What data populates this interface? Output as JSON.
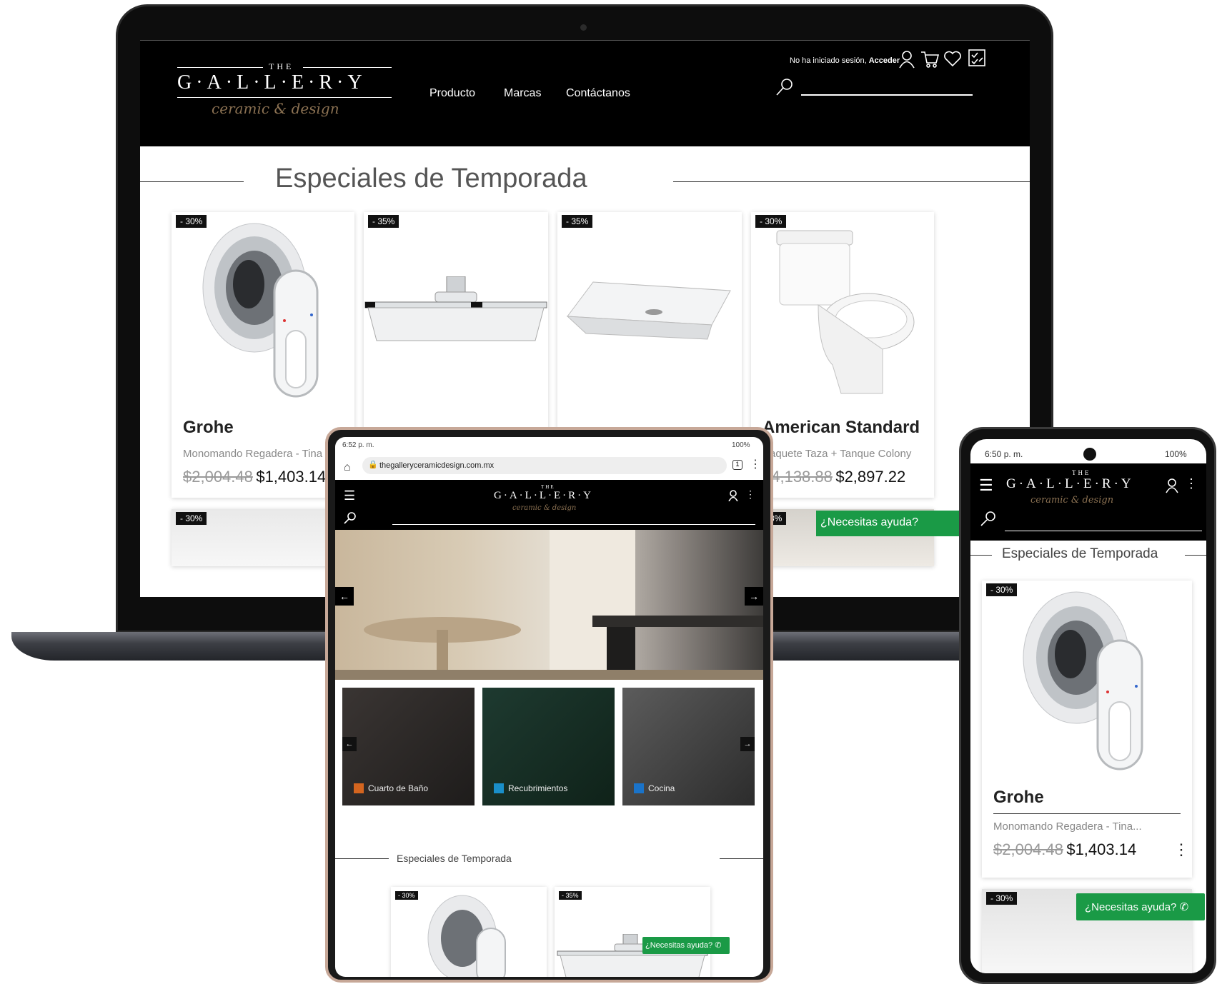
{
  "brand": {
    "the": "THE",
    "name": "G·A·L·L·E·R·Y",
    "tagline": "ceramic & design"
  },
  "colors": {
    "header_bg": "#000000",
    "whatsapp_green": "#1a9a46",
    "badge_bg": "#111111",
    "tagline_gold": "#8b7152"
  },
  "laptop": {
    "nav": [
      "Producto",
      "Marcas",
      "Contáctanos"
    ],
    "login_text": "No ha iniciado sesión,",
    "login_link": "Acceder",
    "icons": [
      "user-icon",
      "cart-icon",
      "heart-icon",
      "compare-icon",
      "search-icon"
    ],
    "section_title": "Especiales de Temporada",
    "products": [
      {
        "badge": "- 30%",
        "brand": "Grohe",
        "desc": "Monomando Regadera - Tina",
        "old": "$2,004.48",
        "new": "$1,403.14",
        "image": "shower-valve"
      },
      {
        "badge": "- 35%",
        "brand": "",
        "desc": "",
        "old": "",
        "new": "",
        "image": "rain-showerhead"
      },
      {
        "badge": "- 35%",
        "brand": "",
        "desc": "",
        "old": "",
        "new": "",
        "image": "vessel-sink"
      },
      {
        "badge": "- 30%",
        "brand": "American Standard",
        "desc": "Paquete Taza + Tanque Colony",
        "old": "$4,138.88",
        "new": "$2,897.22",
        "image": "toilet"
      }
    ],
    "row2_badges": [
      "- 30%",
      "- 38%"
    ],
    "whatsapp": "¿Necesitas ayuda?"
  },
  "tablet": {
    "status_time": "6:52 p. m.",
    "status_battery": "100%",
    "url": "thegalleryceramicdesign.com.mx",
    "tab_count": "1",
    "categories": [
      "Cuarto de Baño",
      "Recubrimientos",
      "Cocina"
    ],
    "category_colors": [
      "#d4651f",
      "#1a8fc9",
      "#1a73c9"
    ],
    "section_title": "Especiales de Temporada",
    "badges": [
      "- 30%",
      "- 35%"
    ],
    "whatsapp": "¿Necesitas ayuda?"
  },
  "phone": {
    "status_time": "6:50 p. m.",
    "status_battery": "100%",
    "section_title": "Especiales de Temporada",
    "product": {
      "badge": "- 30%",
      "brand": "Grohe",
      "desc": "Monomando Regadera - Tina...",
      "old": "$2,004.48",
      "new": "$1,403.14"
    },
    "row2_badge": "- 30%",
    "whatsapp": "¿Necesitas ayuda?"
  }
}
